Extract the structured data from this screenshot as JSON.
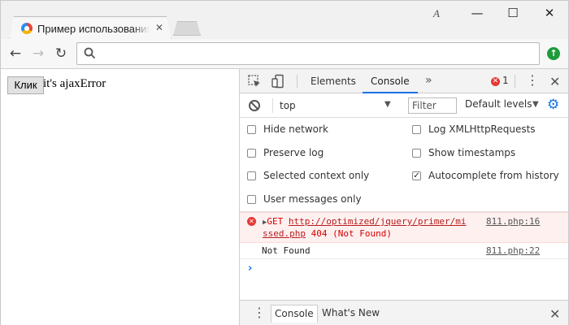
{
  "browser": {
    "tab_title": "Пример использования",
    "tab_close_glyph": "✕",
    "profile_glyph": "A",
    "window_controls": {
      "minimize": "—",
      "maximize": "☐",
      "close": "✕"
    },
    "nav": {
      "back": "←",
      "forward": "→",
      "reload": "↻"
    },
    "omnibox": {
      "value": "",
      "placeholder": ""
    },
    "update_glyph": "↑"
  },
  "page": {
    "button_label": "Клик",
    "text": "it's ajaxError"
  },
  "devtools": {
    "tabs": [
      {
        "label": "Elements",
        "active": false
      },
      {
        "label": "Console",
        "active": true
      }
    ],
    "more_tabs_glyph": "»",
    "error_badge_count": "1",
    "error_glyph": "✕",
    "menu_glyph": "⋮",
    "close_glyph": "✕",
    "console_toolbar": {
      "context": "top",
      "dropdown_glyph": "▼",
      "filter_placeholder": "Filter",
      "levels": "Default levels",
      "settings_glyph": "⚙"
    },
    "settings": [
      {
        "label": "Hide network",
        "checked": false
      },
      {
        "label": "Log XMLHttpRequests",
        "checked": false
      },
      {
        "label": "Preserve log",
        "checked": false
      },
      {
        "label": "Show timestamps",
        "checked": false
      },
      {
        "label": "Selected context only",
        "checked": false
      },
      {
        "label": "Autocomplete from history",
        "checked": true
      },
      {
        "label": "User messages only",
        "checked": false
      }
    ],
    "check_glyph": "✓",
    "messages": {
      "error": {
        "expand_glyph": "▶",
        "method": "GET",
        "url_part1": "http://optimized/jquery/primer/mi",
        "url_part2": "ssed.php",
        "status": "404 (Not Found)",
        "source_part1": "811.php:16"
      },
      "info": {
        "text": "Not Found",
        "source": "811.php:22"
      }
    },
    "prompt_glyph": "›",
    "drawer": {
      "menu_glyph": "⋮",
      "tabs": [
        {
          "label": "Console",
          "active": true
        },
        {
          "label": "What's New",
          "active": false
        }
      ],
      "close_glyph": "✕"
    }
  },
  "colors": {
    "accent": "#1a73e8",
    "error": "#e53935",
    "error_bg": "#fff0f0",
    "update": "#1e9b3b"
  }
}
